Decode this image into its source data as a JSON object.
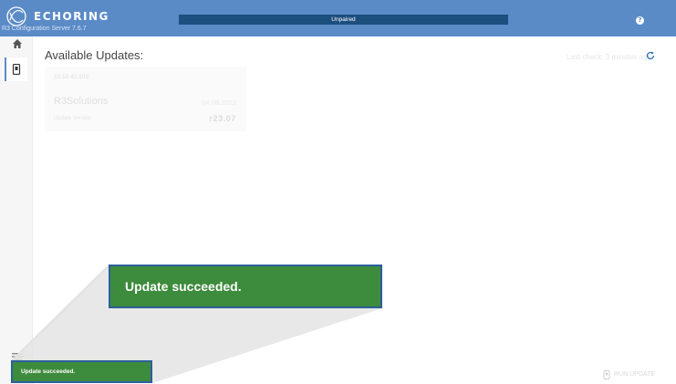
{
  "header": {
    "brand": "ECHORING",
    "subtitle": "R3 Configuration Server 7.6.7",
    "pairing_status": "Unpaired",
    "help_icon": "help-icon",
    "logo_icon": "echoring-logo",
    "colors": {
      "header_bg": "#5b8bc7",
      "pair_bar": "#1c4e7e"
    }
  },
  "nav": {
    "items": [
      {
        "icon": "home-icon"
      },
      {
        "icon": "device-icon"
      }
    ],
    "menu_icon": "menu-icon"
  },
  "main": {
    "title": "Available Updates:",
    "last_check": "Last check: 3 minutes ago",
    "refresh_icon": "refresh-icon",
    "card": {
      "ip": "10.10.42.103",
      "product": "R3Solutions",
      "date": "04.08.2022",
      "version_label": "Update Version",
      "version": "r23.07"
    },
    "run_update_label": "RUN UPDATE"
  },
  "toast": {
    "message": "Update succeeded.",
    "color": "#3d8b3d"
  },
  "zoom_callout": {
    "message": "Update succeeded."
  }
}
